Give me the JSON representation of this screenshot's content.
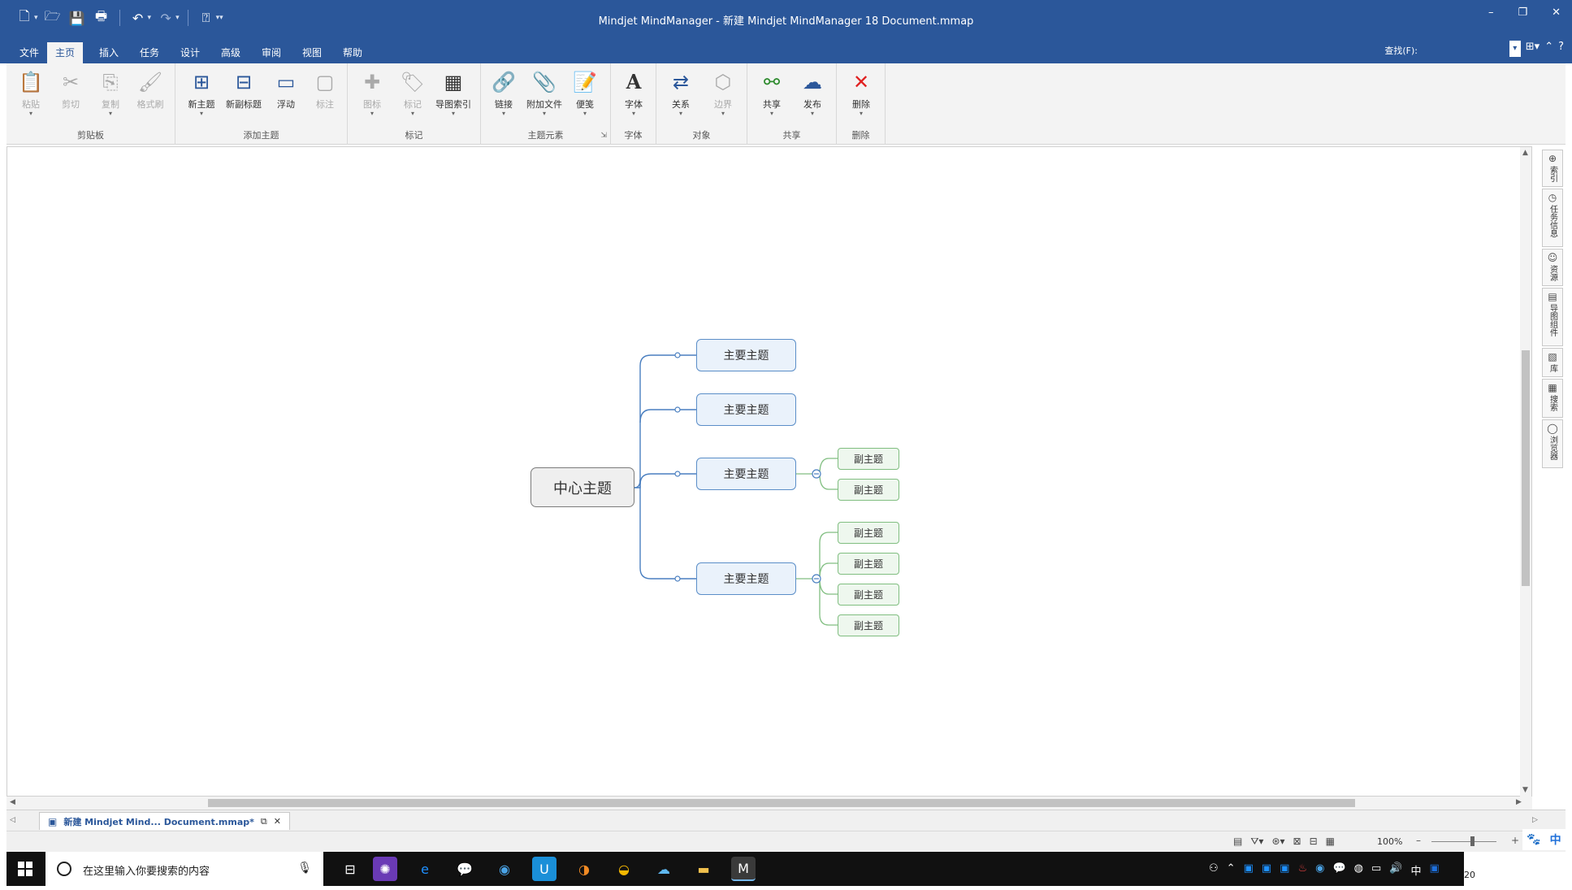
{
  "window": {
    "title": "Mindjet MindManager - 新建 Mindjet MindManager 18 Document.mmap",
    "controls": {
      "minimize": "–",
      "restore": "❐",
      "close": "✕"
    }
  },
  "qat": {
    "icons": [
      "new-icon",
      "open-icon",
      "save-icon",
      "print-icon",
      "undo-icon",
      "redo-icon",
      "help-icon"
    ]
  },
  "tabs": [
    {
      "label": "文件",
      "active": false
    },
    {
      "label": "主页",
      "active": true
    },
    {
      "label": "插入",
      "active": false
    },
    {
      "label": "任务",
      "active": false
    },
    {
      "label": "设计",
      "active": false
    },
    {
      "label": "高级",
      "active": false
    },
    {
      "label": "审阅",
      "active": false
    },
    {
      "label": "视图",
      "active": false
    },
    {
      "label": "帮助",
      "active": false
    }
  ],
  "find": {
    "label": "查找(F):"
  },
  "ribbon": {
    "groups": [
      {
        "label": "剪贴板",
        "buttons": [
          {
            "label": "粘贴",
            "icon": "📋",
            "disabled": true
          },
          {
            "label": "剪切",
            "icon": "✂",
            "disabled": true
          },
          {
            "label": "复制",
            "icon": "⎘",
            "disabled": true
          },
          {
            "label": "格式刷",
            "icon": "🖌",
            "disabled": true
          }
        ]
      },
      {
        "label": "添加主题",
        "buttons": [
          {
            "label": "新主题",
            "icon": "⊞",
            "disabled": false
          },
          {
            "label": "新副标题",
            "icon": "⊟",
            "disabled": false
          },
          {
            "label": "浮动",
            "icon": "▭",
            "disabled": false
          },
          {
            "label": "标注",
            "icon": "▢",
            "disabled": true
          }
        ]
      },
      {
        "label": "标记",
        "buttons": [
          {
            "label": "图标",
            "icon": "✚",
            "disabled": true
          },
          {
            "label": "标记",
            "icon": "🏷",
            "disabled": true
          },
          {
            "label": "导图索引",
            "icon": "▦",
            "disabled": false
          }
        ]
      },
      {
        "label": "主题元素",
        "buttons": [
          {
            "label": "链接",
            "icon": "🔗",
            "disabled": false
          },
          {
            "label": "附加文件",
            "icon": "📎",
            "disabled": false
          },
          {
            "label": "便笺",
            "icon": "📝",
            "disabled": false
          }
        ]
      },
      {
        "label": "字体",
        "buttons": [
          {
            "label": "字体",
            "icon": "A",
            "disabled": false
          }
        ]
      },
      {
        "label": "对象",
        "buttons": [
          {
            "label": "关系",
            "icon": "⇄",
            "disabled": false
          },
          {
            "label": "边界",
            "icon": "⬡",
            "disabled": true
          }
        ]
      },
      {
        "label": "共享",
        "buttons": [
          {
            "label": "共享",
            "icon": "⚯",
            "disabled": false
          },
          {
            "label": "发布",
            "icon": "☁",
            "disabled": false
          }
        ]
      },
      {
        "label": "删除",
        "buttons": [
          {
            "label": "删除",
            "icon": "✕",
            "disabled": false
          }
        ]
      }
    ]
  },
  "map": {
    "central": "中心主题",
    "mains": [
      {
        "label": "主要主题",
        "subs": []
      },
      {
        "label": "主要主题",
        "subs": []
      },
      {
        "label": "主要主题",
        "subs": [
          "副主题",
          "副主题"
        ]
      },
      {
        "label": "主要主题",
        "subs": [
          "副主题",
          "副主题",
          "副主题",
          "副主题"
        ]
      }
    ]
  },
  "sidepanel": [
    {
      "icon": "⊕",
      "label": "索引"
    },
    {
      "icon": "◷",
      "label": "任务信息"
    },
    {
      "icon": "☺",
      "label": "资源"
    },
    {
      "icon": "▤",
      "label": "导图组件"
    },
    {
      "icon": "▧",
      "label": "库"
    },
    {
      "icon": "▦",
      "label": "搜索"
    },
    {
      "icon": "◯",
      "label": "浏览器"
    }
  ],
  "document_tab": {
    "label": "新建 Mindjet Mind... Document.mmap*",
    "close": "✕"
  },
  "status": {
    "zoom": "100%",
    "minus": "–",
    "plus": "+"
  },
  "ime": {
    "label": "中"
  },
  "taskbar": {
    "search_placeholder": "在这里输入你要搜索的内容",
    "tray": {
      "lang": "中",
      "clock": "20"
    }
  }
}
